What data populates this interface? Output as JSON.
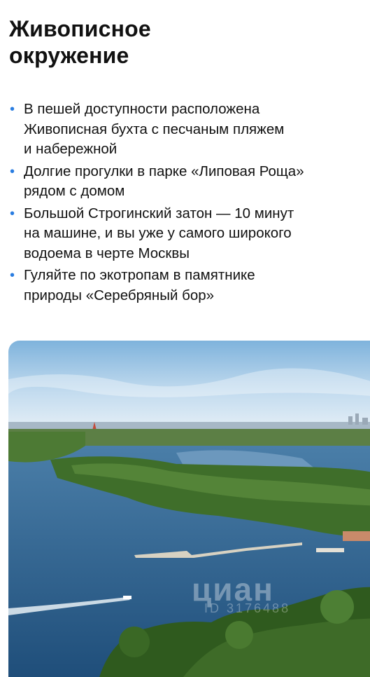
{
  "title": {
    "line1": "Живописное",
    "line2": "окружение"
  },
  "bullets": [
    {
      "lines": [
        "В пешей доступности расположена",
        "Живописная бухта с песчаным пляжем",
        "и набережной"
      ]
    },
    {
      "lines": [
        "Долгие прогулки в парке «Липовая Роща»",
        "рядом с домом"
      ]
    },
    {
      "lines": [
        "Большой Строгинский затон — 10 минут",
        "на машине, и вы уже у самого широкого",
        "водоема в черте Москвы"
      ]
    },
    {
      "lines": [
        "Гуляйте по экотропам в памятнике",
        "природы «Серебряный бор»"
      ]
    }
  ],
  "bullet_symbol": "•",
  "photo": {
    "watermark": "циан",
    "watermark_id": "ID 3176488"
  },
  "colors": {
    "bullet": "#2a7de1",
    "sky": "#cfe3f3",
    "water": "#2f5f8c",
    "trees": "#3f6e2a"
  }
}
